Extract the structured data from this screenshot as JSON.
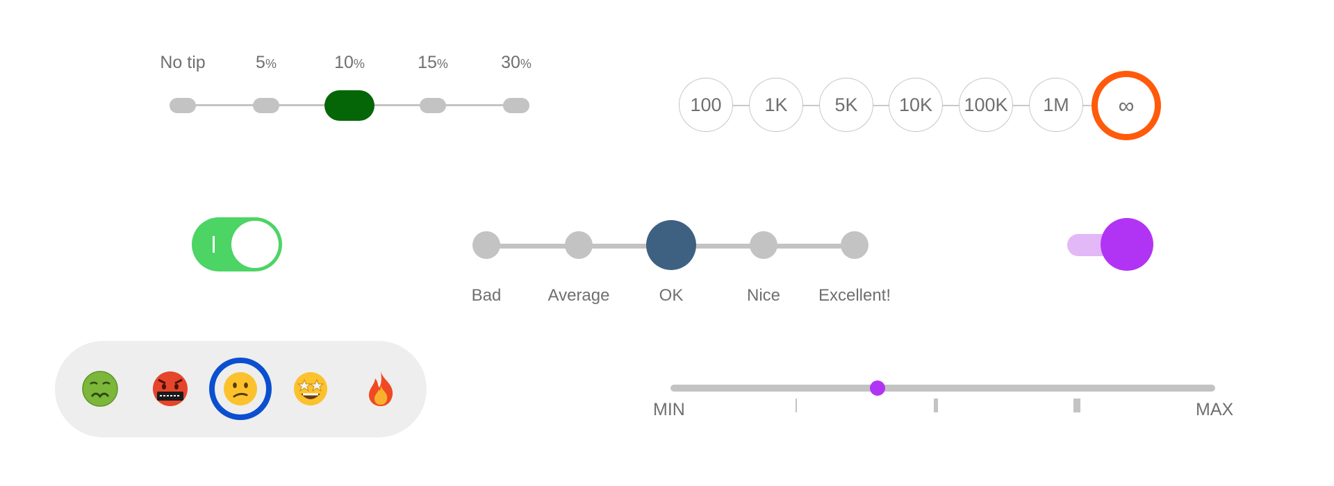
{
  "colors": {
    "tip_selected": "#056608",
    "amount_selected": "#ff5a0b",
    "toggle_on": "#4cd464",
    "rating_selected": "#3e6182",
    "switch_track": "#e3b8f6",
    "switch_knob": "#b134f5",
    "emoji_ring": "#0a4fcf",
    "range_thumb": "#b134f5"
  },
  "tip_slider": {
    "selected_index": 2,
    "options": [
      {
        "main": "No tip",
        "suffix": ""
      },
      {
        "main": "5",
        "suffix": "%"
      },
      {
        "main": "10",
        "suffix": "%"
      },
      {
        "main": "15",
        "suffix": "%"
      },
      {
        "main": "30",
        "suffix": "%"
      }
    ]
  },
  "amount_picker": {
    "selected_index": 6,
    "options": [
      "100",
      "1K",
      "5K",
      "10K",
      "100K",
      "1M",
      "∞"
    ]
  },
  "toggle": {
    "state": "on",
    "on_symbol": "I"
  },
  "rating_slider": {
    "selected_index": 2,
    "options": [
      "Bad",
      "Average",
      "OK",
      "Nice",
      "Excellent!"
    ]
  },
  "purple_switch": {
    "state": "on"
  },
  "emoji_picker": {
    "selected_index": 2,
    "options": [
      "nauseated-face",
      "cursing-face",
      "confused-face",
      "star-struck-face",
      "fire"
    ]
  },
  "range_slider": {
    "min_label": "MIN",
    "max_label": "MAX",
    "value_fraction": 0.38
  }
}
